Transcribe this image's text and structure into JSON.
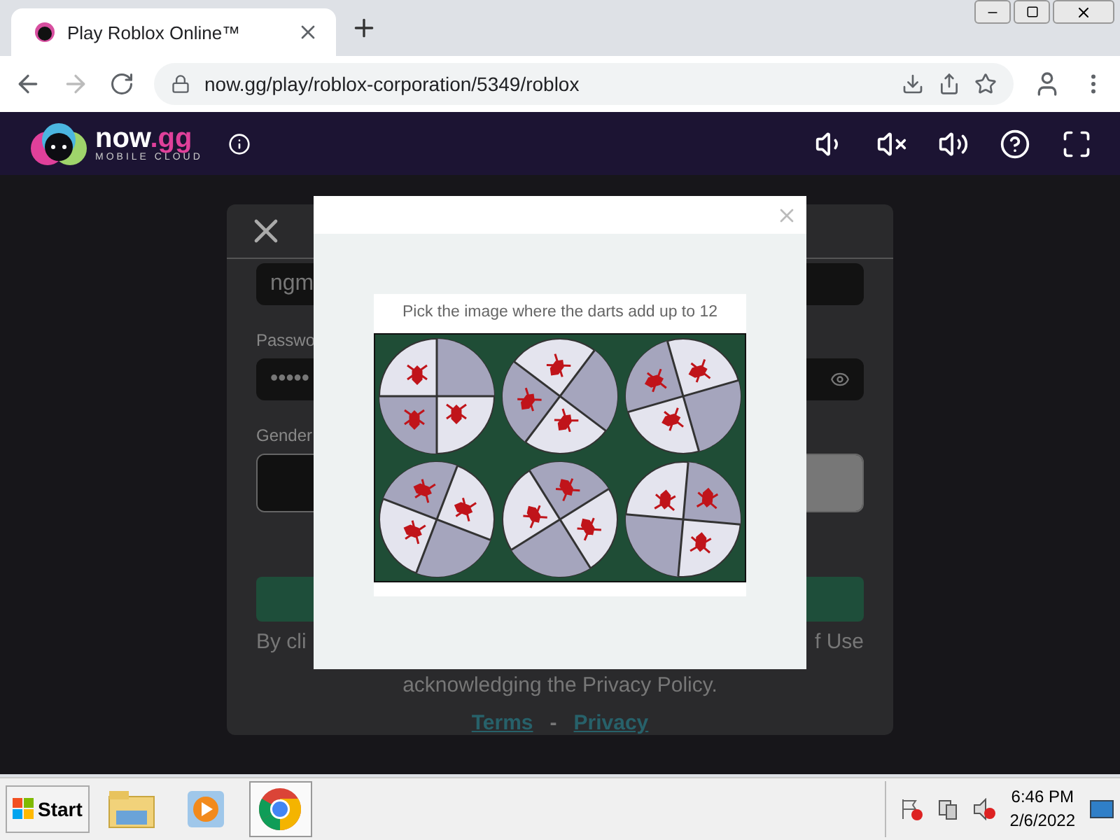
{
  "browser": {
    "tab": {
      "title": "Play Roblox Online™",
      "selected": true
    },
    "address": "now.gg/play/roblox-corporation/5349/roblox"
  },
  "site_header": {
    "logo_name": "now",
    "logo_suffix": ".gg",
    "logo_tagline": "MOBILE CLOUD"
  },
  "login": {
    "username": "ngm",
    "password_label": "Passwo",
    "password": "•••••",
    "gender_label": "Gender",
    "terms_left": "By cli",
    "terms_right": "f Use",
    "terms_line": "acknowledging the Privacy Policy.",
    "links": [
      "Terms",
      "Privacy"
    ],
    "link_separator": "-"
  },
  "captcha": {
    "prompt": "Pick the image where the darts add up to 12"
  },
  "taskbar": {
    "start": "Start",
    "pinned": [
      {
        "kind": "folder",
        "selected": false
      },
      {
        "kind": "media",
        "selected": false
      },
      {
        "kind": "chrome",
        "selected": true
      }
    ],
    "time": "6:46 PM",
    "date": "2/6/2022"
  }
}
